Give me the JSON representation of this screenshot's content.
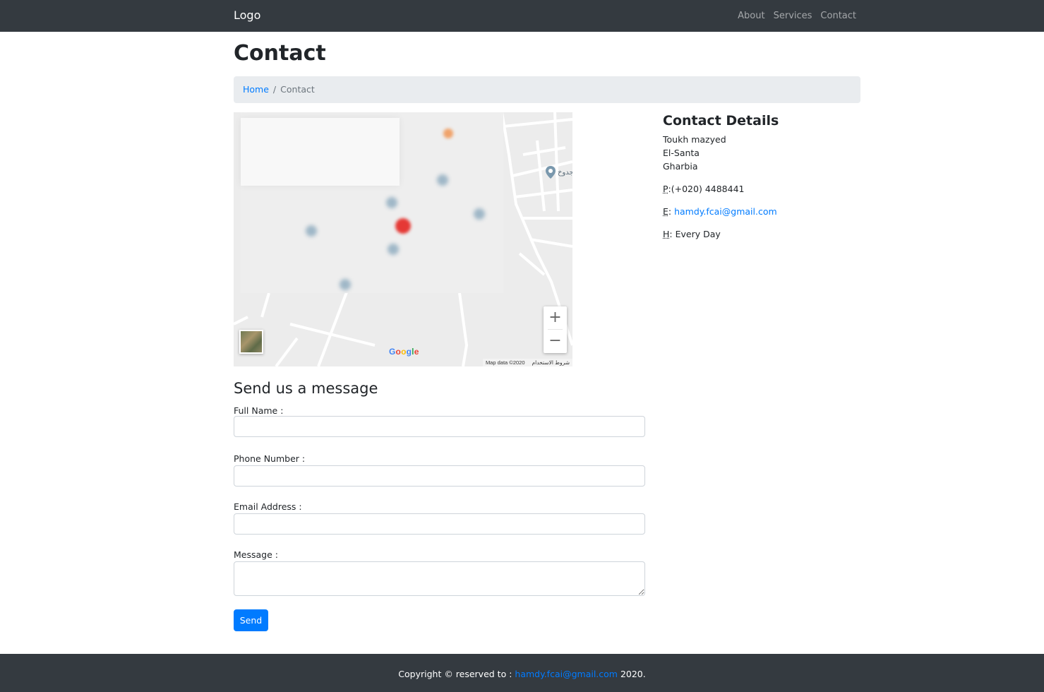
{
  "navbar": {
    "brand": "Logo",
    "links": [
      {
        "label": "About"
      },
      {
        "label": "Services"
      },
      {
        "label": "Contact"
      }
    ]
  },
  "page": {
    "title": "Contact"
  },
  "breadcrumb": {
    "home": "Home",
    "separator": "/",
    "current": "Contact"
  },
  "map": {
    "poi_label": "جدوخ",
    "zoom_in": "+",
    "zoom_out": "−",
    "google_logo": "Google",
    "attribution": "Map data ©2020",
    "terms": "شروط الاستخدام"
  },
  "contact_details": {
    "heading": "Contact Details",
    "address_line1": "Toukh mazyed",
    "address_line2": "El-Santa",
    "address_line3": "Gharbia",
    "phone_abbr": "P",
    "phone": ":(+020) 4488441",
    "email_abbr": "E",
    "email_sep": ": ",
    "email": "hamdy.fcai@gmail.com",
    "hours_abbr": "H",
    "hours": ": Every Day"
  },
  "form": {
    "heading": "Send us a message",
    "full_name_label": "Full Name :",
    "phone_label": "Phone Number :",
    "email_label": "Email Address :",
    "message_label": "Message :",
    "full_name_value": "",
    "phone_value": "",
    "email_value": "",
    "message_value": "",
    "send_label": "Send"
  },
  "footer": {
    "prefix": "Copyright © reserved to : ",
    "email": "hamdy.fcai@gmail.com",
    "suffix": " 2020."
  },
  "colors": {
    "navbar_bg": "#343a40",
    "link": "#007bff",
    "breadcrumb_bg": "#e9ecef",
    "primary_button": "#007bff"
  }
}
